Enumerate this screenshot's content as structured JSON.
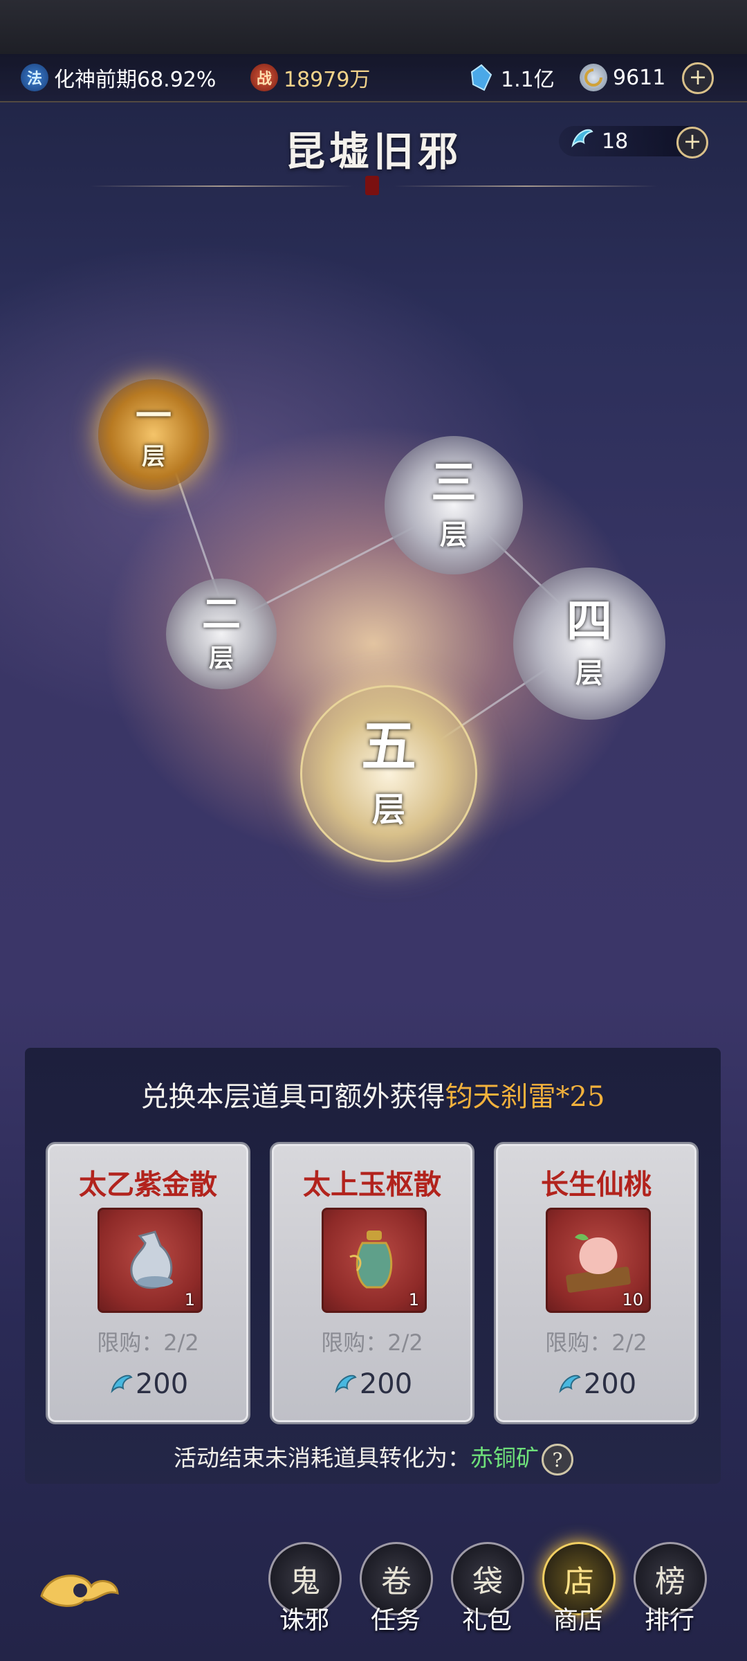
{
  "resources": {
    "cultivation": {
      "icon": "法",
      "label": "化神前期68.92%"
    },
    "combat": {
      "icon": "战",
      "value": "18979万"
    },
    "crystal": {
      "value": "1.1亿"
    },
    "spirit_stone": {
      "value": "9611"
    },
    "plus": "+"
  },
  "page": {
    "title": "昆墟旧邪",
    "token_count": "18",
    "plus": "+"
  },
  "map": {
    "nodes": [
      {
        "label_top": "一",
        "label_bottom": "层",
        "state": "active"
      },
      {
        "label_top": "二",
        "label_bottom": "层",
        "state": "locked"
      },
      {
        "label_top": "三",
        "label_bottom": "层",
        "state": "locked"
      },
      {
        "label_top": "四",
        "label_bottom": "层",
        "state": "locked"
      },
      {
        "label_top": "五",
        "label_bottom": "层",
        "state": "highlight"
      }
    ]
  },
  "shop": {
    "headline_prefix": "兑换本层道具可额外获得",
    "headline_reward": "钧天刹雷*25",
    "items": [
      {
        "name": "太乙紫金散",
        "qty": "1",
        "limit": "限购：2/2",
        "price": "200"
      },
      {
        "name": "太上玉枢散",
        "qty": "1",
        "limit": "限购：2/2",
        "price": "200"
      },
      {
        "name": "长生仙桃",
        "qty": "10",
        "limit": "限购：2/2",
        "price": "200"
      }
    ],
    "footer_prefix": "活动结束未消耗道具转化为：",
    "footer_item": "赤铜矿",
    "help": "?"
  },
  "nav": {
    "items": [
      {
        "label": "诛邪",
        "glyph": "鬼"
      },
      {
        "label": "任务",
        "glyph": "卷"
      },
      {
        "label": "礼包",
        "glyph": "袋"
      },
      {
        "label": "商店",
        "glyph": "店"
      },
      {
        "label": "排行",
        "glyph": "榜"
      }
    ],
    "active_index": 3
  },
  "colors": {
    "accent_gold": "#f2b13c",
    "name_red": "#b2231d",
    "footer_green": "#6ee07a"
  }
}
